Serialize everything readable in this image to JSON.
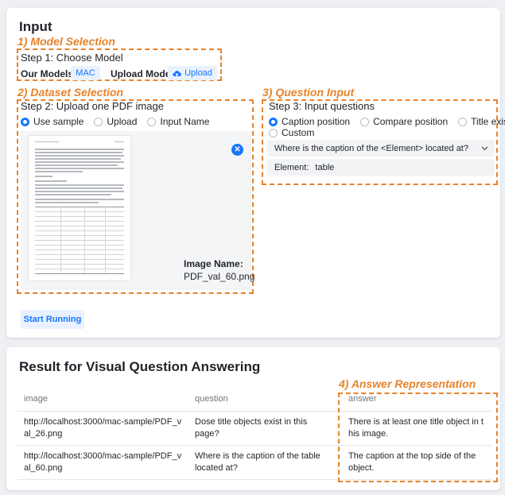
{
  "input_card": {
    "title": "Input",
    "start_button": "Start Running"
  },
  "annotations": {
    "model_selection": "1) Model Selection",
    "dataset_selection": "2) Dataset Selection",
    "question_input": "3) Question Input",
    "answer_representation": "4) Answer Representation"
  },
  "model": {
    "step_title": "Step 1: Choose Model",
    "our_models_label": "Our Models:",
    "model_chip": "MAC",
    "upload_model_label": "Upload Model:",
    "upload_button": "Upload",
    "upload_icon": "cloud-upload-icon"
  },
  "dataset": {
    "step_title": "Step 2: Upload one PDF image",
    "options": [
      "Use sample",
      "Upload",
      "Input Name"
    ],
    "selected_index": 0,
    "image_name_label": "Image Name:",
    "image_name": "PDF_val_60.png",
    "close_icon": "close-icon"
  },
  "question": {
    "step_title": "Step 3: Input questions",
    "options": [
      "Caption position",
      "Compare position",
      "Title exist",
      "Custom"
    ],
    "selected_index": 0,
    "selected_question": "Where is the caption of the <Element> located at?",
    "element_label": "Element:",
    "element_value": "table",
    "dropdown_icon": "chevron-down-icon"
  },
  "result": {
    "title": "Result for Visual Question Answering",
    "columns": [
      "image",
      "question",
      "answer"
    ],
    "rows": [
      {
        "image": "http://localhost:3000/mac-sample/PDF_val_26.png",
        "question": "Dose title objects exist in this page?",
        "answer": "There is at least one title object in this image."
      },
      {
        "image": "http://localhost:3000/mac-sample/PDF_val_60.png",
        "question": "Where is the caption of the table located at?",
        "answer": "The caption at the top side of the object."
      }
    ]
  },
  "colors": {
    "accent": "#1677ff",
    "annotation": "#e8822a"
  }
}
